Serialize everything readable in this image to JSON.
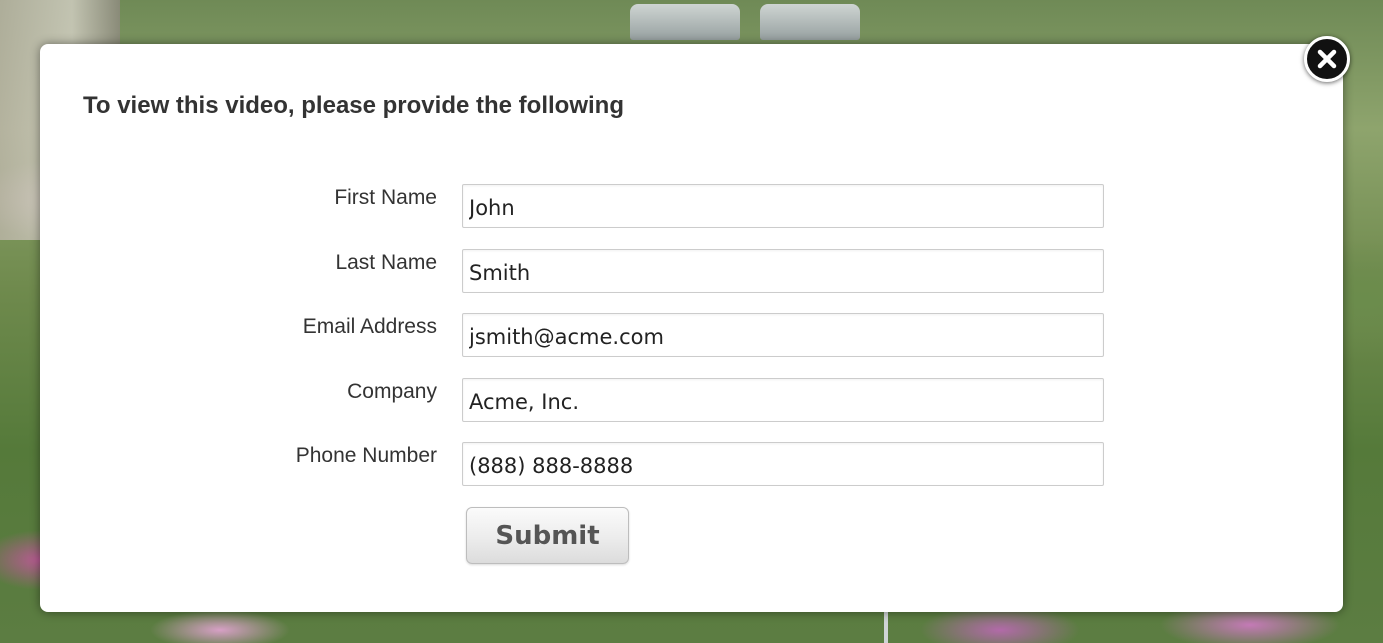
{
  "modal": {
    "title": "To view this video, please provide the following",
    "close_icon": "close-icon",
    "fields": [
      {
        "label": "First Name",
        "value": "John"
      },
      {
        "label": "Last Name",
        "value": "Smith"
      },
      {
        "label": "Email Address",
        "value": "jsmith@acme.com"
      },
      {
        "label": "Company",
        "value": "Acme, Inc."
      },
      {
        "label": "Phone Number",
        "value": "(888) 888-8888"
      }
    ],
    "submit_label": "Submit"
  }
}
